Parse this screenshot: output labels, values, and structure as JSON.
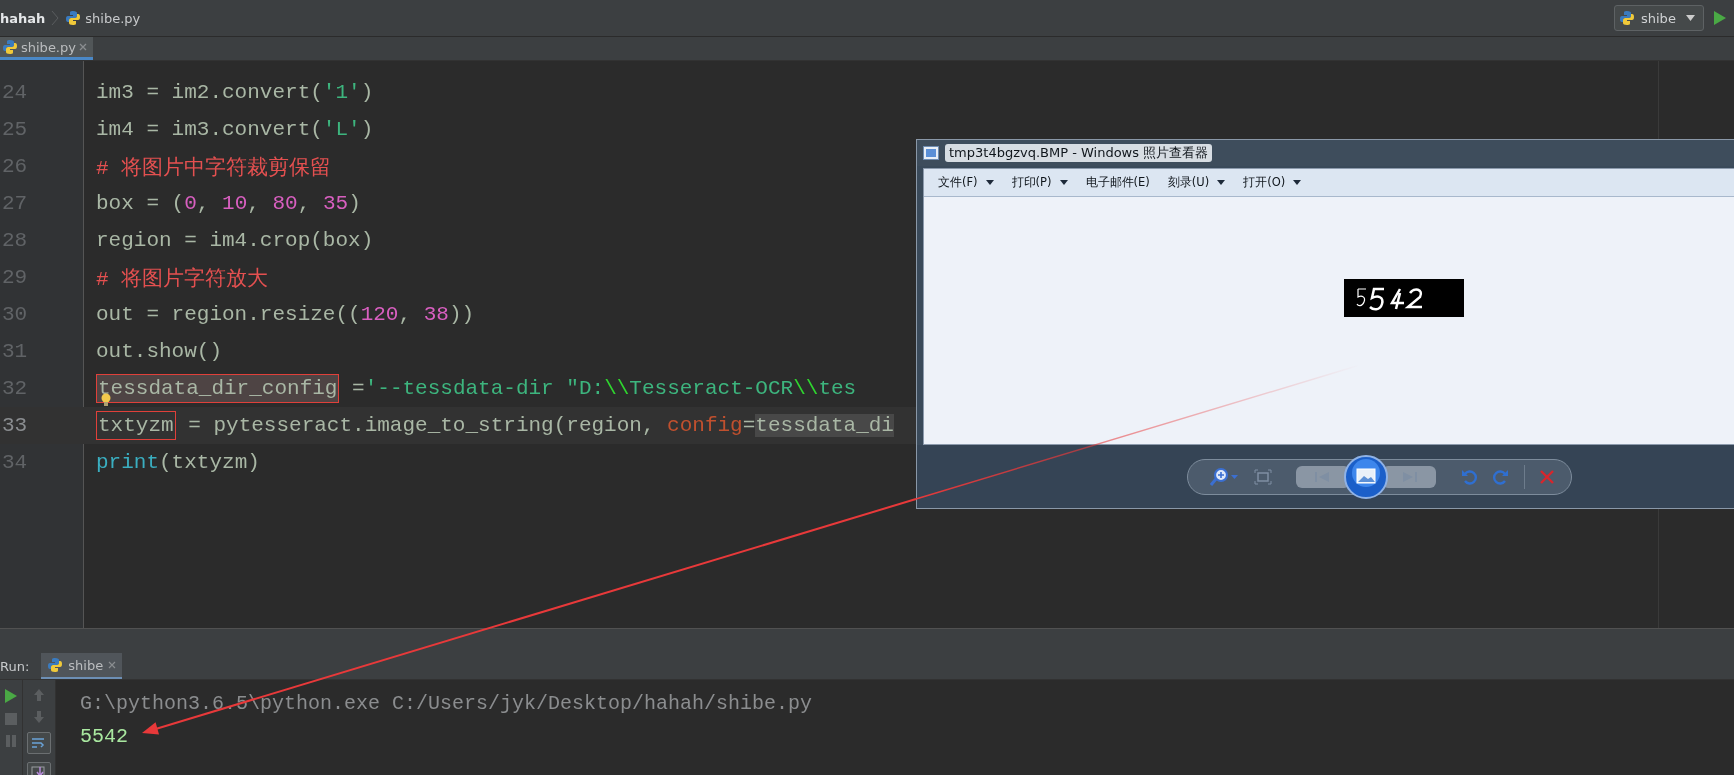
{
  "breadcrumb": [
    {
      "label": "hahah",
      "kind": "folder"
    },
    {
      "label": "shibe.py",
      "kind": "file"
    }
  ],
  "run_config": {
    "label": "shibe"
  },
  "editor_tabs": [
    {
      "label": "shibe.py",
      "selected": true
    }
  ],
  "code_lines": [
    {
      "number": "24",
      "current": false,
      "tokens": [
        {
          "text": "im3 = im2.convert(",
          "kind": "plain"
        },
        {
          "text": "'1'",
          "kind": "string"
        },
        {
          "text": ")",
          "kind": "plain"
        }
      ]
    },
    {
      "number": "25",
      "current": false,
      "tokens": [
        {
          "text": "im4 = im3.convert(",
          "kind": "plain"
        },
        {
          "text": "'L'",
          "kind": "string"
        },
        {
          "text": ")",
          "kind": "plain"
        }
      ]
    },
    {
      "number": "26",
      "current": false,
      "tokens": [
        {
          "text": "# 将图片中字符裁剪保留",
          "kind": "comment"
        }
      ]
    },
    {
      "number": "27",
      "current": false,
      "tokens": [
        {
          "text": "box = (",
          "kind": "plain"
        },
        {
          "text": "0",
          "kind": "number"
        },
        {
          "text": ", ",
          "kind": "plain"
        },
        {
          "text": "10",
          "kind": "number"
        },
        {
          "text": ", ",
          "kind": "plain"
        },
        {
          "text": "80",
          "kind": "number"
        },
        {
          "text": ", ",
          "kind": "plain"
        },
        {
          "text": "35",
          "kind": "number"
        },
        {
          "text": ")",
          "kind": "plain"
        }
      ]
    },
    {
      "number": "28",
      "current": false,
      "tokens": [
        {
          "text": "region = im4.crop(box)",
          "kind": "plain"
        }
      ]
    },
    {
      "number": "29",
      "current": false,
      "tokens": [
        {
          "text": "# 将图片字符放大",
          "kind": "comment"
        }
      ]
    },
    {
      "number": "30",
      "current": false,
      "tokens": [
        {
          "text": "out = region.resize((",
          "kind": "plain"
        },
        {
          "text": "120",
          "kind": "number"
        },
        {
          "text": ", ",
          "kind": "plain"
        },
        {
          "text": "38",
          "kind": "number"
        },
        {
          "text": "))",
          "kind": "plain"
        }
      ]
    },
    {
      "number": "31",
      "current": false,
      "tokens": [
        {
          "text": "out.show()",
          "kind": "plain"
        }
      ]
    },
    {
      "number": "32",
      "current": false,
      "bulb": true,
      "tokens": [
        {
          "text": "tessdata_dir_config",
          "kind": "plain",
          "boxed": true,
          "usage": true
        },
        {
          "text": " =",
          "kind": "plain"
        },
        {
          "text": "'--tessdata-dir \"D:",
          "kind": "string"
        },
        {
          "text": "\\\\",
          "kind": "escape"
        },
        {
          "text": "Tesseract-OCR",
          "kind": "string"
        },
        {
          "text": "\\\\",
          "kind": "escape"
        },
        {
          "text": "tes",
          "kind": "string"
        }
      ]
    },
    {
      "number": "33",
      "current": true,
      "tokens": [
        {
          "text": "txtyzm",
          "kind": "plain",
          "boxed": true
        },
        {
          "text": " = pytesseract.image_to_string(region, ",
          "kind": "plain"
        },
        {
          "text": "config",
          "kind": "param"
        },
        {
          "text": "=",
          "kind": "plain"
        },
        {
          "text": "tessdata_di",
          "kind": "plain",
          "usage": true
        }
      ]
    },
    {
      "number": "34",
      "current": false,
      "tokens": [
        {
          "text": "print",
          "kind": "builtin"
        },
        {
          "text": "(txtyzm)",
          "kind": "plain"
        }
      ]
    }
  ],
  "photo_viewer": {
    "title": "tmp3t4bgzvq.BMP - Windows 照片查看器",
    "menu": [
      {
        "label": "文件(F)",
        "dropdown": true
      },
      {
        "label": "打印(P)",
        "dropdown": true
      },
      {
        "label": "电子邮件(E)",
        "dropdown": false
      },
      {
        "label": "刻录(U)",
        "dropdown": true
      },
      {
        "label": "打开(O)",
        "dropdown": true
      }
    ]
  },
  "run_panel": {
    "label": "Run:",
    "tabs": [
      {
        "label": "shibe",
        "selected": true
      }
    ],
    "output": [
      {
        "text": "G:\\python3.6.5\\python.exe C:/Users/jyk/Desktop/hahah/shibe.py",
        "kind": "command"
      },
      {
        "text": "5542",
        "kind": "result"
      }
    ]
  }
}
